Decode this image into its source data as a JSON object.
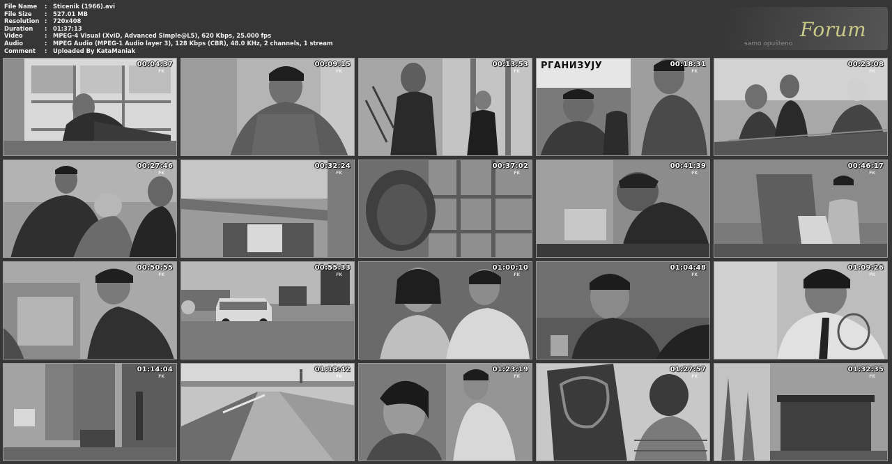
{
  "info": [
    {
      "label": "File Name",
      "value": "Sticenik (1966).avi"
    },
    {
      "label": "File Size",
      "value": "527.01 MB"
    },
    {
      "label": "Resolution",
      "value": "720x408"
    },
    {
      "label": "Duration",
      "value": "01:37:13"
    },
    {
      "label": "Video",
      "value": "MPEG-4 Visual (XviD, Advanced Simple@L5), 620 Kbps, 25.000 fps"
    },
    {
      "label": "Audio",
      "value": "MPEG Audio (MPEG-1 Audio layer 3), 128 Kbps (CBR), 48.0 KHz, 2 channels, 1 stream"
    },
    {
      "label": "Comment",
      "value": "Uploaded By KataManiak"
    }
  ],
  "separator": ":",
  "logo": {
    "word": "Forum",
    "subtitle": "samo opušteno"
  },
  "watermark": "FK",
  "sign_text": "РГАНИЗУЈУ",
  "thumbnails": [
    {
      "time": "00:04:37"
    },
    {
      "time": "00:09:15"
    },
    {
      "time": "00:13:53"
    },
    {
      "time": "00:18:31"
    },
    {
      "time": "00:23:08"
    },
    {
      "time": "00:27:46"
    },
    {
      "time": "00:32:24"
    },
    {
      "time": "00:37:02"
    },
    {
      "time": "00:41:39"
    },
    {
      "time": "00:46:17"
    },
    {
      "time": "00:50:55"
    },
    {
      "time": "00:55:33"
    },
    {
      "time": "01:00:10"
    },
    {
      "time": "01:04:48"
    },
    {
      "time": "01:09:26"
    },
    {
      "time": "01:14:04"
    },
    {
      "time": "01:18:42"
    },
    {
      "time": "01:23:19"
    },
    {
      "time": "01:27:57"
    },
    {
      "time": "01:32:35"
    }
  ]
}
